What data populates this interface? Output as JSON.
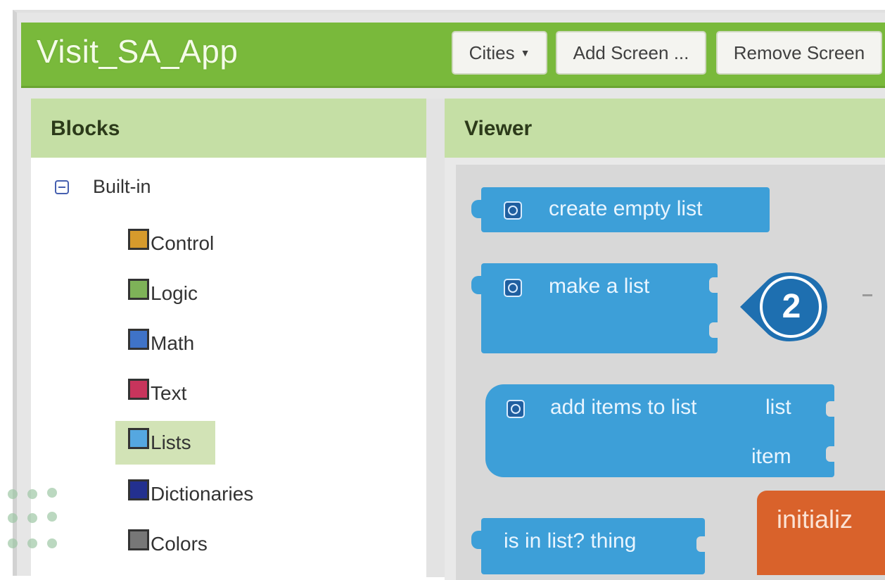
{
  "app": {
    "title": "Visit_SA_App"
  },
  "toolbar": {
    "screen_select": "Cities",
    "add_screen": "Add Screen ...",
    "remove_screen": "Remove Screen"
  },
  "blocks_panel": {
    "title": "Blocks",
    "root_label": "Built-in",
    "categories": [
      {
        "label": "Control",
        "color": "#d69a2c"
      },
      {
        "label": "Logic",
        "color": "#7eb258"
      },
      {
        "label": "Math",
        "color": "#3f73c8"
      },
      {
        "label": "Text",
        "color": "#c8345c"
      },
      {
        "label": "Lists",
        "color": "#55a7e0"
      },
      {
        "label": "Dictionaries",
        "color": "#23308f"
      },
      {
        "label": "Colors",
        "color": "#777777"
      }
    ],
    "selected": "Lists"
  },
  "viewer": {
    "title": "Viewer",
    "blocks": {
      "create_empty": "create empty list",
      "make_list": "make a list",
      "add_items": "add items to list",
      "add_items_list": "list",
      "add_items_item": "item",
      "is_in_list": "is in list? thing",
      "initialize": "initializ"
    },
    "callout_number": "2"
  },
  "colors": {
    "header_green": "#79b93b",
    "panel_header": "#c5dfa5",
    "list_block": "#3d9fd8",
    "variable_block": "#d9622b",
    "callout": "#1e6fb0"
  }
}
